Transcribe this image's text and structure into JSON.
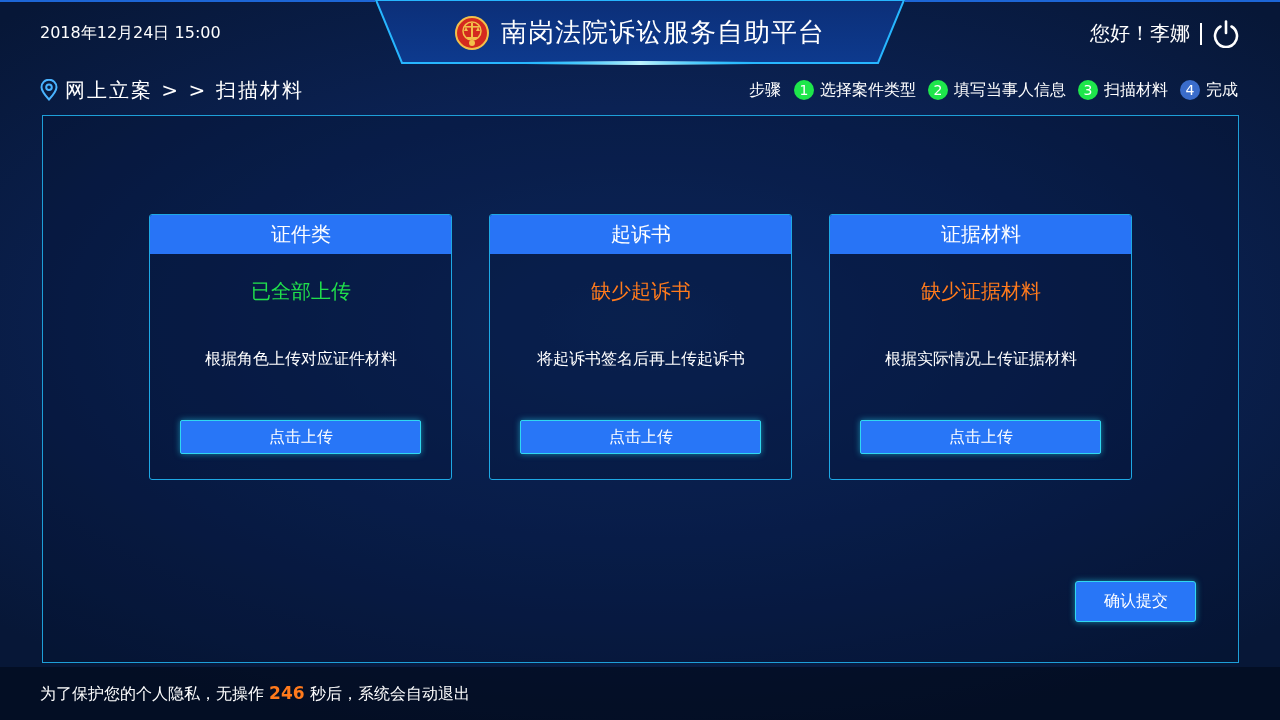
{
  "header": {
    "datetime": "2018年12月24日 15:00",
    "title": "南岗法院诉讼服务自助平台",
    "greeting": "您好！李娜"
  },
  "breadcrumb": "网上立案 > > 扫描材料",
  "steps": {
    "label": "步骤",
    "items": [
      {
        "number": "1",
        "label": "选择案件类型",
        "completed": true
      },
      {
        "number": "2",
        "label": "填写当事人信息",
        "completed": true
      },
      {
        "number": "3",
        "label": "扫描材料",
        "completed": true
      },
      {
        "number": "4",
        "label": "完成",
        "completed": false
      }
    ]
  },
  "cards": [
    {
      "title": "证件类",
      "status": "已全部上传",
      "complete": true,
      "description": "根据角色上传对应证件材料",
      "button": "点击上传"
    },
    {
      "title": "起诉书",
      "status": "缺少起诉书",
      "complete": false,
      "description": "将起诉书签名后再上传起诉书",
      "button": "点击上传"
    },
    {
      "title": "证据材料",
      "status": "缺少证据材料",
      "complete": false,
      "description": "根据实际情况上传证据材料",
      "button": "点击上传"
    }
  ],
  "submit_button": "确认提交",
  "footer": {
    "notice": "为了保护您的个人隐私，无操作 **246** 秒后，系统会自动退出"
  }
}
